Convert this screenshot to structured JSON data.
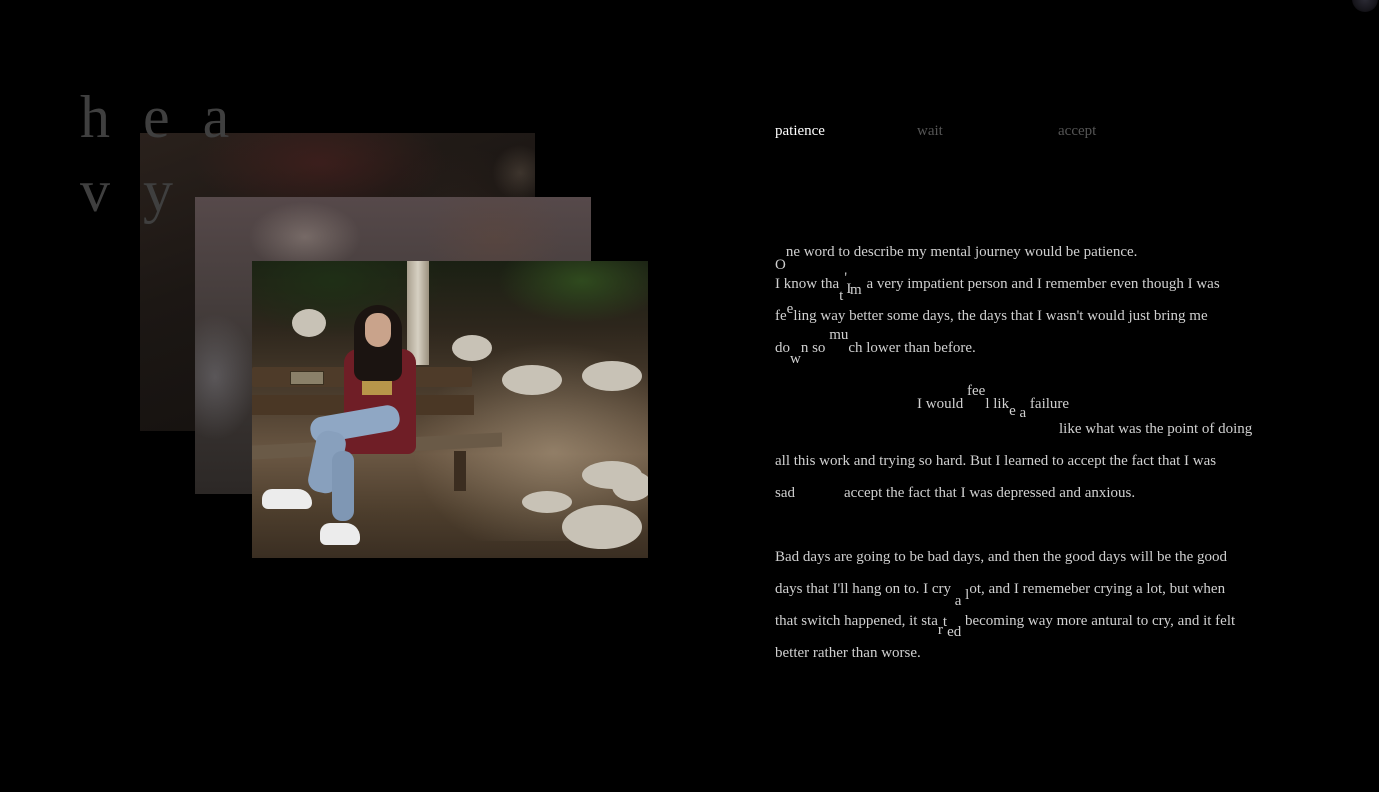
{
  "title": {
    "line1": "h e a",
    "line2": "v y"
  },
  "nav": {
    "tabs": [
      {
        "label": "patience",
        "active": true
      },
      {
        "label": "wait",
        "active": false
      },
      {
        "label": "accept",
        "active": false
      }
    ]
  },
  "story": {
    "p1": {
      "l1_drop": "O",
      "l1_rest": "ne word to describe my mental journey would be patience.",
      "l2_a": "I know tha",
      "l2_t": "t",
      "l2_i": "I",
      "l2_apos": "'",
      "l2_m": "m",
      "l2_rest": " a very impatient person and I remember even though I was",
      "l3_a": "fe",
      "l3_e": "e",
      "l3_rest": "ling way better some days, the days that I wasn't would just bring me",
      "l4_a": "do",
      "l4_w": "w",
      "l4_b": "n so ",
      "l4_mu": "mu",
      "l4_rest": "ch lower than before."
    },
    "p2": {
      "l1_a": "I would ",
      "l1_fee": "fee",
      "l1_b": "l lik",
      "l1_e": "e",
      "l1_sp": " ",
      "l1_a2": "a",
      "l1_rest": " failure",
      "l2": "like what was the point of doing",
      "l3": "all this work and trying so hard. But I learned to accept the fact that I was",
      "l4_a": "sad",
      "l4_b": "accept the fact that I was depressed and anxious."
    },
    "p3": {
      "l1": "Bad days are going to be bad days, and then the good days will be the good",
      "l2_a": "days that I'll hang on to. I cry ",
      "l2_a2": "a",
      "l2_sp": " ",
      "l2_l": "l",
      "l2_rest": "ot, and I rememeber crying a lot, but when",
      "l3_a": "that switch happened, it sta",
      "l3_r": "r",
      "l3_t": "t",
      "l3_ed": "ed",
      "l3_rest": " becoming way more antural to cry, and it felt",
      "l4": "better rather than worse."
    }
  },
  "colors": {
    "background": "#000000",
    "text": "#d0d0d0",
    "active_tab": "#ffffff",
    "inactive_tab": "#555555",
    "title": "#3f3f3f"
  }
}
